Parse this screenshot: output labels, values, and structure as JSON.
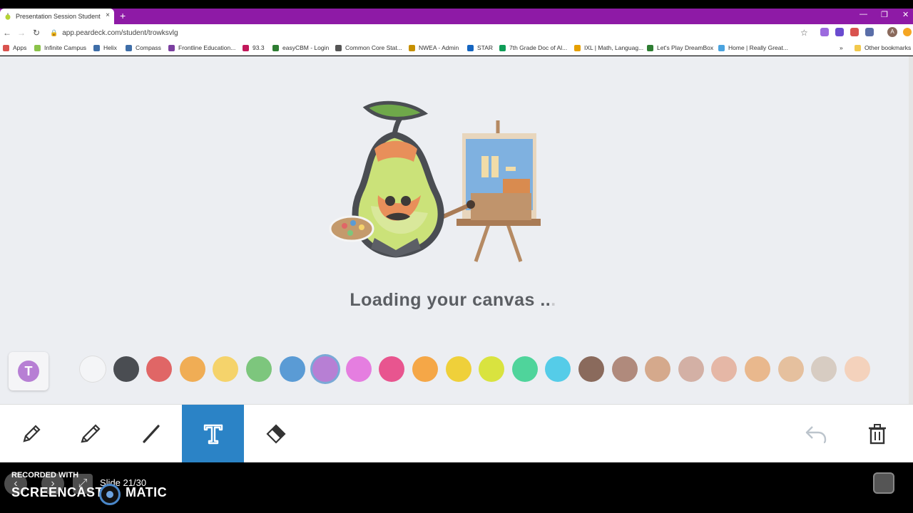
{
  "browser": {
    "tab_title": "Presentation Session Student",
    "tab_close": "×",
    "new_tab": "+",
    "url": "app.peardeck.com/student/trowksvlg",
    "profile_initial": "A"
  },
  "bookmarks": [
    {
      "label": "Apps",
      "color": "#d9534f"
    },
    {
      "label": "Infinite Campus",
      "color": "#8bc34a"
    },
    {
      "label": "Helix",
      "color": "#3f6ea8"
    },
    {
      "label": "Compass",
      "color": "#3f6ea8"
    },
    {
      "label": "Frontline Education...",
      "color": "#7b3fa0"
    },
    {
      "label": "93.3",
      "color": "#c2185b"
    },
    {
      "label": "easyCBM - Login",
      "color": "#2e7d32"
    },
    {
      "label": "Common Core Stat...",
      "color": "#555555"
    },
    {
      "label": "NWEA - Admin",
      "color": "#c69000"
    },
    {
      "label": "STAR",
      "color": "#1565c0"
    },
    {
      "label": "7th Grade Doc of Al...",
      "color": "#0f9d58"
    },
    {
      "label": "IXL | Math, Languag...",
      "color": "#e6a000"
    },
    {
      "label": "Let's Play DreamBox",
      "color": "#2e7d32"
    },
    {
      "label": "Home | Really Great...",
      "color": "#4aa3df"
    }
  ],
  "bookmarks_more": "»",
  "other_bookmarks": "Other bookmarks",
  "canvas": {
    "loading_text": "Loading your canvas ",
    "dots_dark": "..",
    "dots_light": "."
  },
  "text_badge_letter": "T",
  "palette": [
    "#f4f5f7",
    "#4a4d52",
    "#e06666",
    "#f0ad55",
    "#f5d36b",
    "#7dc67d",
    "#5a9bd5",
    "#b77fd4",
    "#e57ee0",
    "#e8558f",
    "#f5a747",
    "#efd03a",
    "#d9e33f",
    "#4fd49b",
    "#55cce8",
    "#8a6a5c",
    "#b08a7c",
    "#d5a98c",
    "#d3b0a5",
    "#e5b7a6",
    "#e9b88d",
    "#e5c09e",
    "#d7ccc2",
    "#f4d2bc"
  ],
  "selected_color": "#b77fd4",
  "tools": [
    {
      "name": "pencil-tool",
      "icon": "pencil-icon"
    },
    {
      "name": "marker-tool",
      "icon": "marker-icon"
    },
    {
      "name": "line-tool",
      "icon": "line-icon"
    },
    {
      "name": "text-tool",
      "icon": "text-icon"
    },
    {
      "name": "eraser-tool",
      "icon": "eraser-icon"
    }
  ],
  "active_tool": "text-tool",
  "player": {
    "slide_label": "Slide 21/30"
  },
  "watermark": {
    "line1": "RECORDED WITH",
    "line2": "SCREENCAST",
    "line3": "MATIC"
  }
}
